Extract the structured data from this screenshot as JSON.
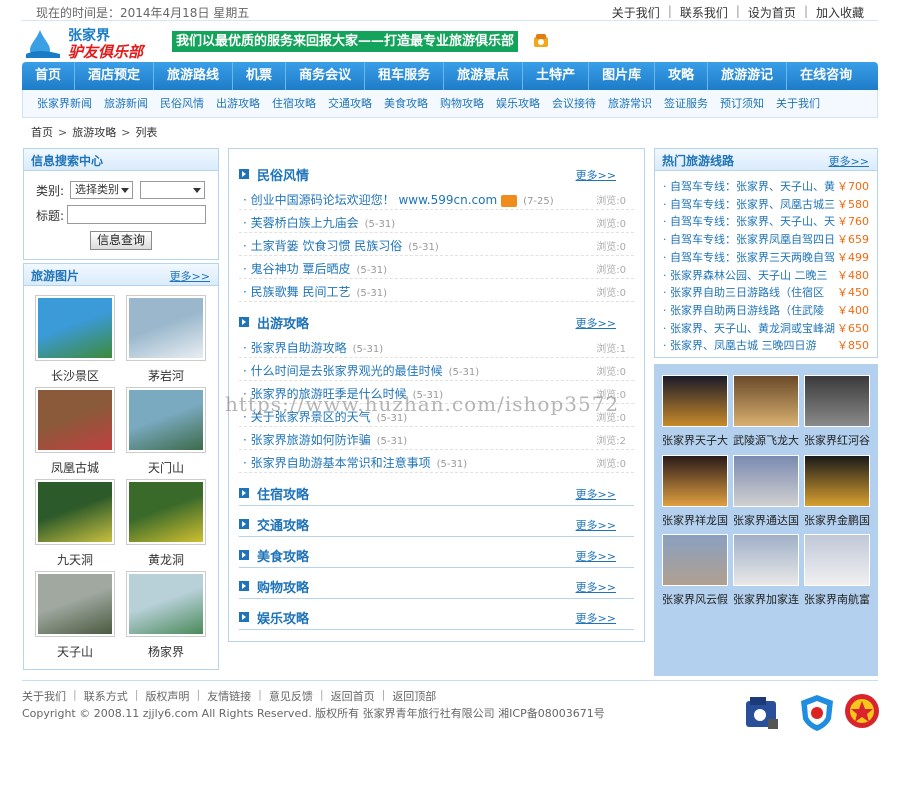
{
  "topbar": {
    "time": "现在的时间是：2014年4月18日 星期五",
    "links": [
      "关于我们",
      "联系我们",
      "设为首页",
      "加入收藏"
    ]
  },
  "header": {
    "logo_line1": "张家界",
    "logo_line2": "驴友俱乐部",
    "slogan": "我们以最优质的服务来回报大家——打造最专业旅游俱乐部"
  },
  "mainnav": [
    "首页",
    "酒店预定",
    "旅游路线",
    "机票",
    "商务会议",
    "租车服务",
    "旅游景点",
    "土特产",
    "图片库",
    "攻略",
    "旅游游记",
    "在线咨询"
  ],
  "subnav": [
    "张家界新闻",
    "旅游新闻",
    "民俗风情",
    "出游攻略",
    "住宿攻略",
    "交通攻略",
    "美食攻略",
    "购物攻略",
    "娱乐攻略",
    "会议接待",
    "旅游常识",
    "签证服务",
    "预订须知",
    "关于我们"
  ],
  "breadcrumb": [
    "首页",
    "旅游攻略",
    "列表"
  ],
  "search": {
    "title": "信息搜索中心",
    "category_label": "类别:",
    "category_value": "选择类别",
    "subcategory_value": "",
    "title_label": "标题:",
    "title_value": "",
    "button": "信息查询"
  },
  "photos": {
    "title": "旅游图片",
    "more": "更多>>",
    "items": [
      "长沙景区",
      "茅岩河",
      "凤凰古城",
      "天门山",
      "九天洞",
      "黄龙洞",
      "天子山",
      "杨家界"
    ]
  },
  "center": {
    "sections": [
      {
        "title": "民俗风情",
        "more": "更多>>",
        "articles": [
          {
            "title": "创业中国源码论坛欢迎您！ www.599cn.com",
            "date": "(7-25)",
            "views": "浏览:0"
          },
          {
            "title": "芙蓉桥白族上九庙会",
            "date": "(5-31)",
            "views": "浏览:0"
          },
          {
            "title": "土家背篓   饮食习惯   民族习俗",
            "date": "(5-31)",
            "views": "浏览:0"
          },
          {
            "title": "鬼谷神功 覃后晒皮",
            "date": "(5-31)",
            "views": "浏览:0"
          },
          {
            "title": "民族歌舞 民间工艺",
            "date": "(5-31)",
            "views": "浏览:0"
          }
        ]
      },
      {
        "title": "出游攻略",
        "more": "更多>>",
        "articles": [
          {
            "title": "张家界自助游攻略",
            "date": "(5-31)",
            "views": "浏览:1"
          },
          {
            "title": "什么时间是去张家界观光的最佳时候",
            "date": "(5-31)",
            "views": "浏览:0"
          },
          {
            "title": "张家界的旅游旺季是什么时候",
            "date": "(5-31)",
            "views": "浏览:0"
          },
          {
            "title": "关于张家界景区的天气",
            "date": "(5-31)",
            "views": "浏览:0"
          },
          {
            "title": "张家界旅游如何防诈骗",
            "date": "(5-31)",
            "views": "浏览:2"
          },
          {
            "title": "张家界自助游基本常识和注意事项",
            "date": "(5-31)",
            "views": "浏览:0"
          }
        ]
      },
      {
        "title": "住宿攻略",
        "more": "更多>>",
        "articles": []
      },
      {
        "title": "交通攻略",
        "more": "更多>>",
        "articles": []
      },
      {
        "title": "美食攻略",
        "more": "更多>>",
        "articles": []
      },
      {
        "title": "购物攻略",
        "more": "更多>>",
        "articles": []
      },
      {
        "title": "娱乐攻略",
        "more": "更多>>",
        "articles": []
      }
    ]
  },
  "hot": {
    "title": "热门旅游线路",
    "more": "更多>>",
    "items": [
      {
        "name": "· 自驾车专线：张家界、天子山、黄",
        "price": "￥700"
      },
      {
        "name": "· 自驾车专线：张家界、凤凰古城三晚四",
        "price": "￥580"
      },
      {
        "name": "· 自驾车专线：张家界、天子山、天",
        "price": "￥760"
      },
      {
        "name": "· 自驾车专线：张家界凤凰自驾四日",
        "price": "￥659"
      },
      {
        "name": "· 自驾车专线：张家界三天两晚自驾",
        "price": "￥499"
      },
      {
        "name": "· 张家界森林公园、天子山 二晚三",
        "price": "￥480"
      },
      {
        "name": "· 张家界自助三日游路线（住宿区",
        "price": "￥450"
      },
      {
        "name": "· 张家界自助两日游线路（住武陵",
        "price": "￥400"
      },
      {
        "name": "· 张家界、天子山、黄龙洞或宝峰湖",
        "price": "￥650"
      },
      {
        "name": "· 张家界、凤凰古城 三晚四日游",
        "price": "￥850"
      }
    ]
  },
  "hotels": [
    "张家界天子大",
    "武陵源飞龙大",
    "张家界红河谷",
    "张家界祥龙国",
    "张家界通达国",
    "张家界金鹏国",
    "张家界风云假",
    "张家界加家连",
    "张家界南航富"
  ],
  "footer": {
    "links": [
      "关于我们",
      "联系方式",
      "版权声明",
      "友情链接",
      "意见反馈",
      "返回首页",
      "返回顶部"
    ],
    "copyright": "Copyright © 2008.11 zjjly6.com  All Rights Reserved.  版权所有  张家界青年旅行社有限公司  湘ICP备08003671号"
  },
  "watermark": "https://www.huzhan.com/ishop3572"
}
